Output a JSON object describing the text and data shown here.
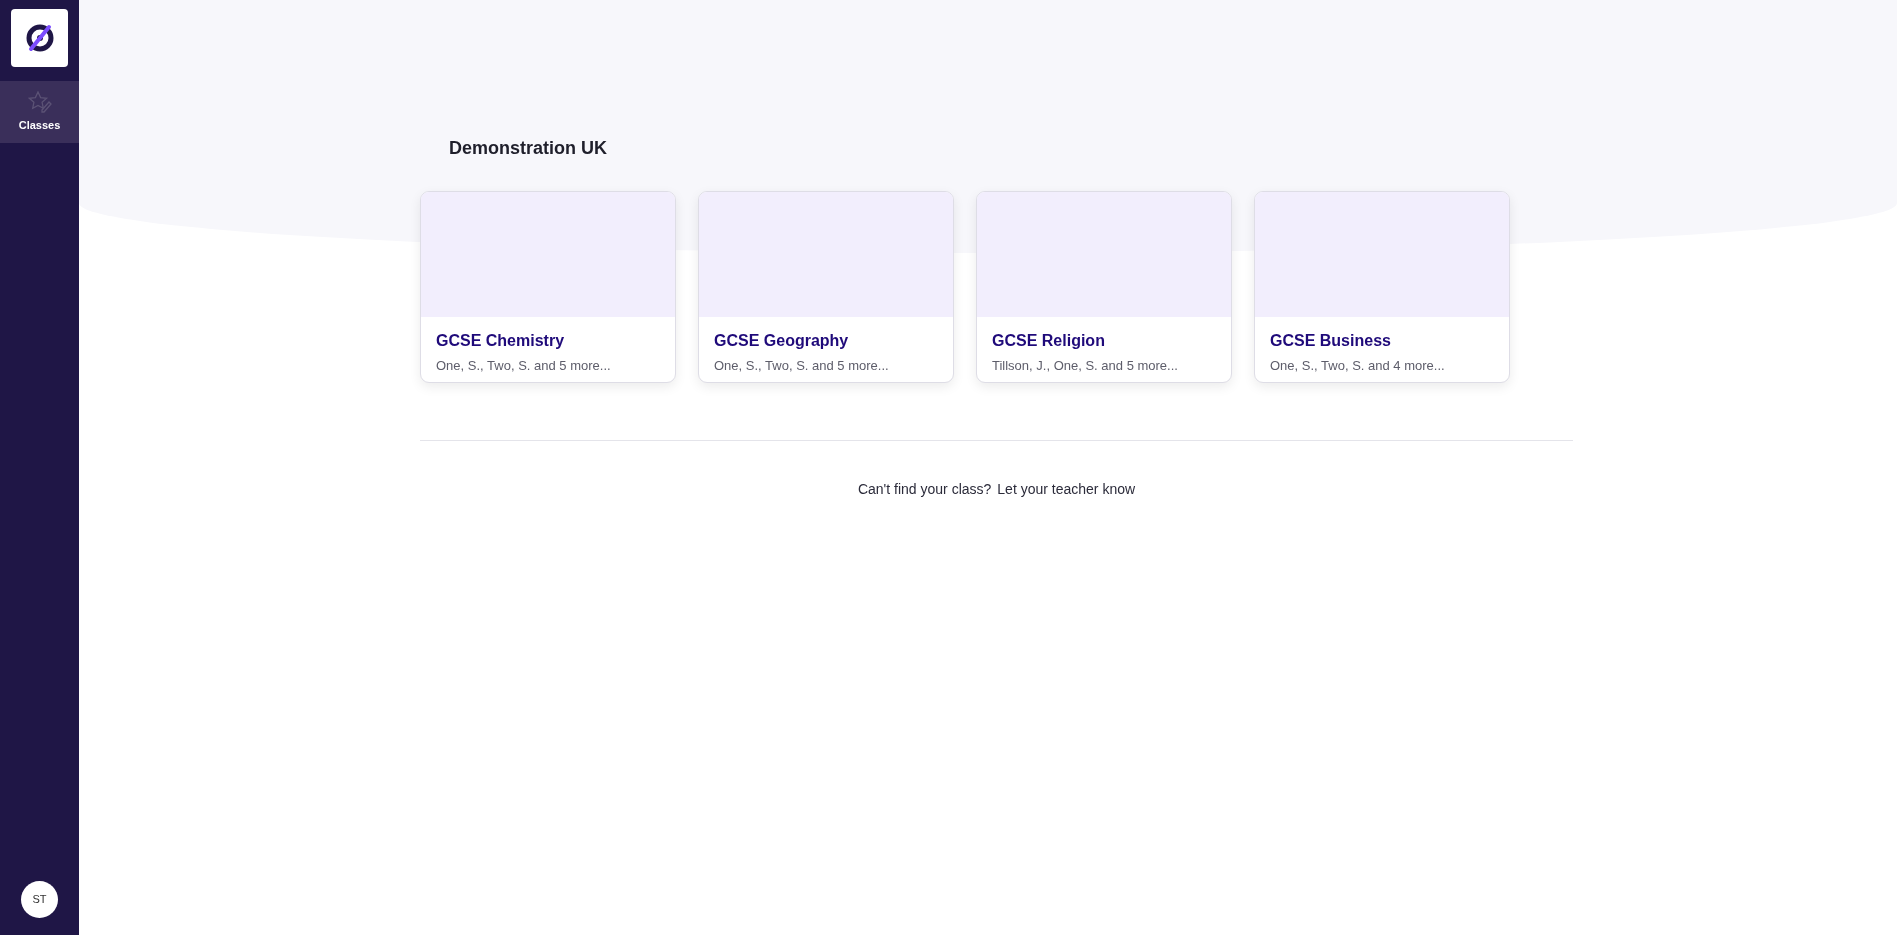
{
  "sidebar": {
    "items": [
      {
        "label": "Classes",
        "selected": true
      }
    ],
    "avatar": "ST"
  },
  "heading": "Demonstration UK",
  "classes": [
    {
      "title": "GCSE Chemistry",
      "members": "One, S., Two, S. and 5 more..."
    },
    {
      "title": "GCSE Geography",
      "members": "One, S., Two, S. and 5 more..."
    },
    {
      "title": "GCSE Religion",
      "members": "Tillson, J., One, S. and 5 more..."
    },
    {
      "title": "GCSE Business",
      "members": "One, S., Two, S. and 4 more..."
    }
  ],
  "footer": {
    "question": "Can't find your class?",
    "hint": "Let your teacher know"
  }
}
